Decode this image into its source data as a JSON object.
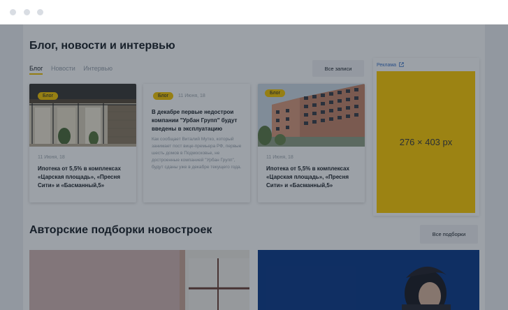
{
  "window": {
    "dots": 3
  },
  "blog": {
    "title": "Блог, новости и интервью",
    "tabs": [
      "Блог",
      "Новости",
      "Интервью"
    ],
    "all_button": "Все записи",
    "cards": [
      {
        "badge": "Блог",
        "date": "11 Июня, 18",
        "title": "Ипотека от 5,5% в комплексах «Царская площадь», «Пресня Сити» и «Басманный,5»"
      },
      {
        "badge": "Блог",
        "date": "11 Июня, 18",
        "title": "В декабре первые недострои компании \"Урбан Групп\" будут введены в эксплуатацию",
        "excerpt": "Как сообщает Виталий Мутко, который занимает пост вице-премьера РФ, первые шесть домов в Подмосковье, не достроенные компанией \"Урбан Групп\", будут сданы уже в декабре текущего года."
      },
      {
        "badge": "Блог",
        "date": "11 Июня, 18",
        "title": "Ипотека от 5,5% в комплексах «Царская площадь», «Пресня Сити» и «Басманный,5»"
      }
    ]
  },
  "ad": {
    "label": "Реклама",
    "placeholder": "276 × 403 px",
    "color": "#ffcc00"
  },
  "collections": {
    "title": "Авторские подборки новостроек",
    "all_button": "Все подборки"
  },
  "colors": {
    "accent": "#f5c400",
    "link": "#3b73c8",
    "overlay": "rgba(20,30,45,0.42)"
  }
}
